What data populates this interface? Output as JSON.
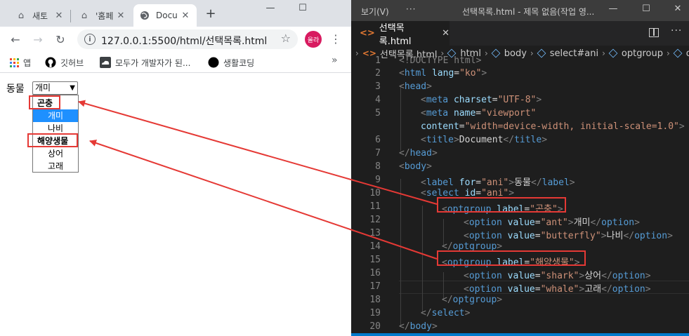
{
  "browser": {
    "tabs": [
      {
        "title": "새토",
        "icon": "home-icon"
      },
      {
        "title": "'홈페",
        "icon": "home-icon"
      },
      {
        "title": "Docu",
        "icon": "globe-icon"
      }
    ],
    "window_controls": {
      "minimize": "—",
      "maximize": "☐"
    },
    "url": "127.0.0.1:5500/html/선택목록.html",
    "profile_label": "올라",
    "bookmarks": [
      {
        "label": "앱",
        "icon": "apps-icon"
      },
      {
        "label": "깃허브",
        "icon": "github-icon"
      },
      {
        "label": "모두가 개발자가 된...",
        "icon": "cloud-icon"
      },
      {
        "label": "생활코딩",
        "icon": "circle-icon"
      }
    ],
    "bookmarks_more": "»"
  },
  "page": {
    "label": "동물",
    "select_value": "개미",
    "dropdown": [
      {
        "text": "곤충",
        "kind": "group"
      },
      {
        "text": "개미",
        "kind": "option",
        "selected": true
      },
      {
        "text": "나비",
        "kind": "option"
      },
      {
        "text": "해양생물",
        "kind": "group"
      },
      {
        "text": "상어",
        "kind": "option"
      },
      {
        "text": "고래",
        "kind": "option"
      }
    ]
  },
  "vscode": {
    "menu_view": "보기(V)",
    "menu_more": "···",
    "window_title": "선택목록.html - 제목 없음(작업 영...",
    "tab_title": "선택목록.html",
    "breadcrumbs": [
      "선택목록.html",
      "html",
      "body",
      "select#ani",
      "optgroup",
      "o"
    ],
    "line_numbers": [
      "1",
      "2",
      "3",
      "4",
      "5",
      "",
      "6",
      "7",
      "8",
      "9",
      "10",
      "11",
      "12",
      "13",
      "14",
      "15",
      "16",
      "17",
      "18",
      "19",
      "20"
    ],
    "code": {
      "l1": "<!DOCTYPE html>",
      "l2_tag": "html",
      "l2_attr": "lang",
      "l2_val": "\"ko\"",
      "l3": "head",
      "l4_tag": "meta",
      "l4_attr": "charset",
      "l4_val": "\"UTF-8\"",
      "l5_tag": "meta",
      "l5_attr": "name",
      "l5_val": "\"viewport\"",
      "l5b_attr": "content",
      "l5b_val": "\"width=device-width, initial-scale=1.0\"",
      "l6_tag": "title",
      "l6_text": "Document",
      "l7": "head",
      "l8": "body",
      "l9_tag": "label",
      "l9_attr": "for",
      "l9_val": "\"ani\"",
      "l9_text": "동물",
      "l10_tag": "select",
      "l10_attr": "id",
      "l10_val": "\"ani\"",
      "l11_tag": "optgroup",
      "l11_attr": "label",
      "l11_val": "\"곤충\"",
      "l12_tag": "option",
      "l12_attr": "value",
      "l12_val": "\"ant\"",
      "l12_text": "개미",
      "l13_tag": "option",
      "l13_attr": "value",
      "l13_val": "\"butterfly\"",
      "l13_text": "나비",
      "l14": "optgroup",
      "l15_tag": "optgroup",
      "l15_attr": "label",
      "l15_val": "\"해양생물\"",
      "l16_tag": "option",
      "l16_attr": "value",
      "l16_val": "\"shark\"",
      "l16_text": "상어",
      "l17_tag": "option",
      "l17_attr": "value",
      "l17_val": "\"whale\"",
      "l17_text": "고래",
      "l18": "optgroup",
      "l19": "select",
      "l20": "body"
    }
  },
  "colors": {
    "annotation_red": "#e53935",
    "selected_option": "#1e90ff",
    "vscode_tag": "#569cd6",
    "vscode_attr": "#9cdcfe",
    "vscode_string": "#ce9178"
  }
}
